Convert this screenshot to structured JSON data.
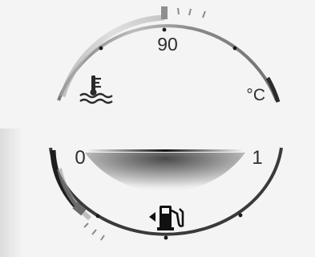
{
  "coolant_gauge": {
    "label_mid": "90",
    "unit": "°C",
    "icon": "coolant-temperature-icon"
  },
  "fuel_gauge": {
    "label_empty": "0",
    "label_full": "1",
    "icon": "fuel-pump-icon",
    "filler_side": "left"
  },
  "colors": {
    "background": "#f4f4f4",
    "arc": "#3a3a3a",
    "arc_light": "#9a9a9a",
    "text": "#2e2e2e",
    "tick_dot": "#1a1a1a"
  }
}
